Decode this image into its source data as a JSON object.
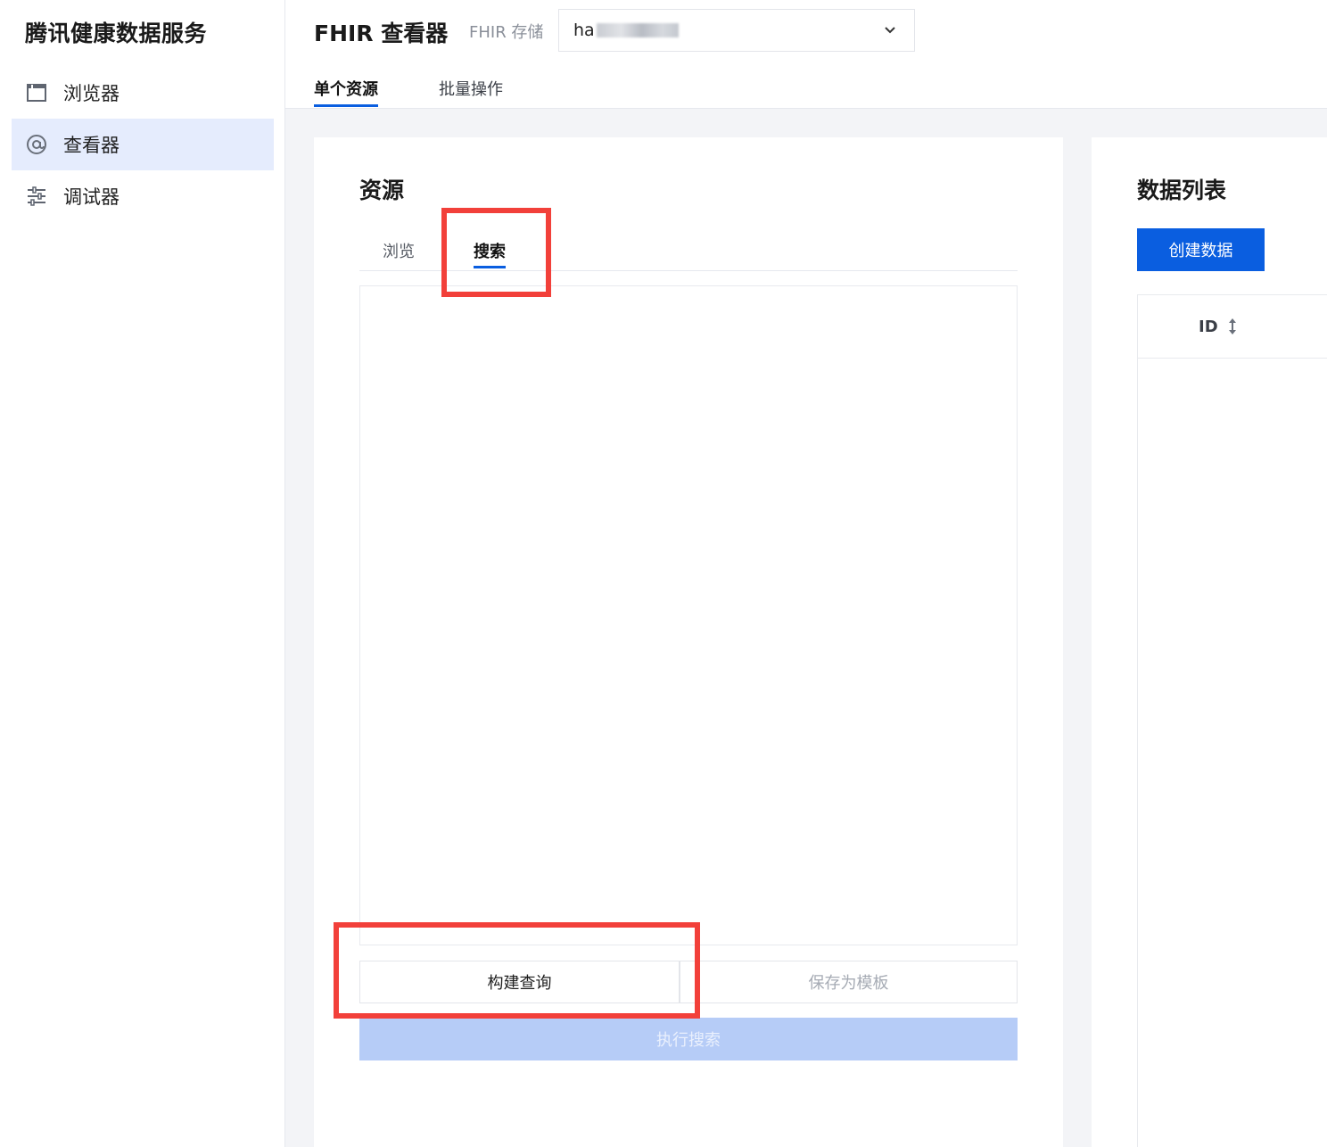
{
  "sidebar": {
    "brand": "腾讯健康数据服务",
    "items": [
      {
        "label": "浏览器",
        "icon": "window-icon",
        "active": false
      },
      {
        "label": "查看器",
        "icon": "at-sign-icon",
        "active": true
      },
      {
        "label": "调试器",
        "icon": "sliders-icon",
        "active": false
      }
    ]
  },
  "header": {
    "title": "FHIR 查看器",
    "store_label": "FHIR 存储",
    "store_value_prefix": "ha",
    "tabs": [
      {
        "label": "单个资源",
        "active": true
      },
      {
        "label": "批量操作",
        "active": false
      }
    ]
  },
  "resource_panel": {
    "title": "资源",
    "tabs": [
      {
        "label": "浏览",
        "active": false
      },
      {
        "label": "搜索",
        "active": true
      }
    ],
    "build_query_label": "构建查询",
    "save_template_label": "保存为模板",
    "execute_search_label": "执行搜索"
  },
  "data_panel": {
    "title": "数据列表",
    "create_label": "创建数据",
    "columns": [
      "ID"
    ]
  },
  "colors": {
    "primary": "#0a5ee0",
    "active_nav_bg": "#e5ecfd",
    "annotation": "#f2403a",
    "disabled_primary": "#b6ccf7"
  }
}
